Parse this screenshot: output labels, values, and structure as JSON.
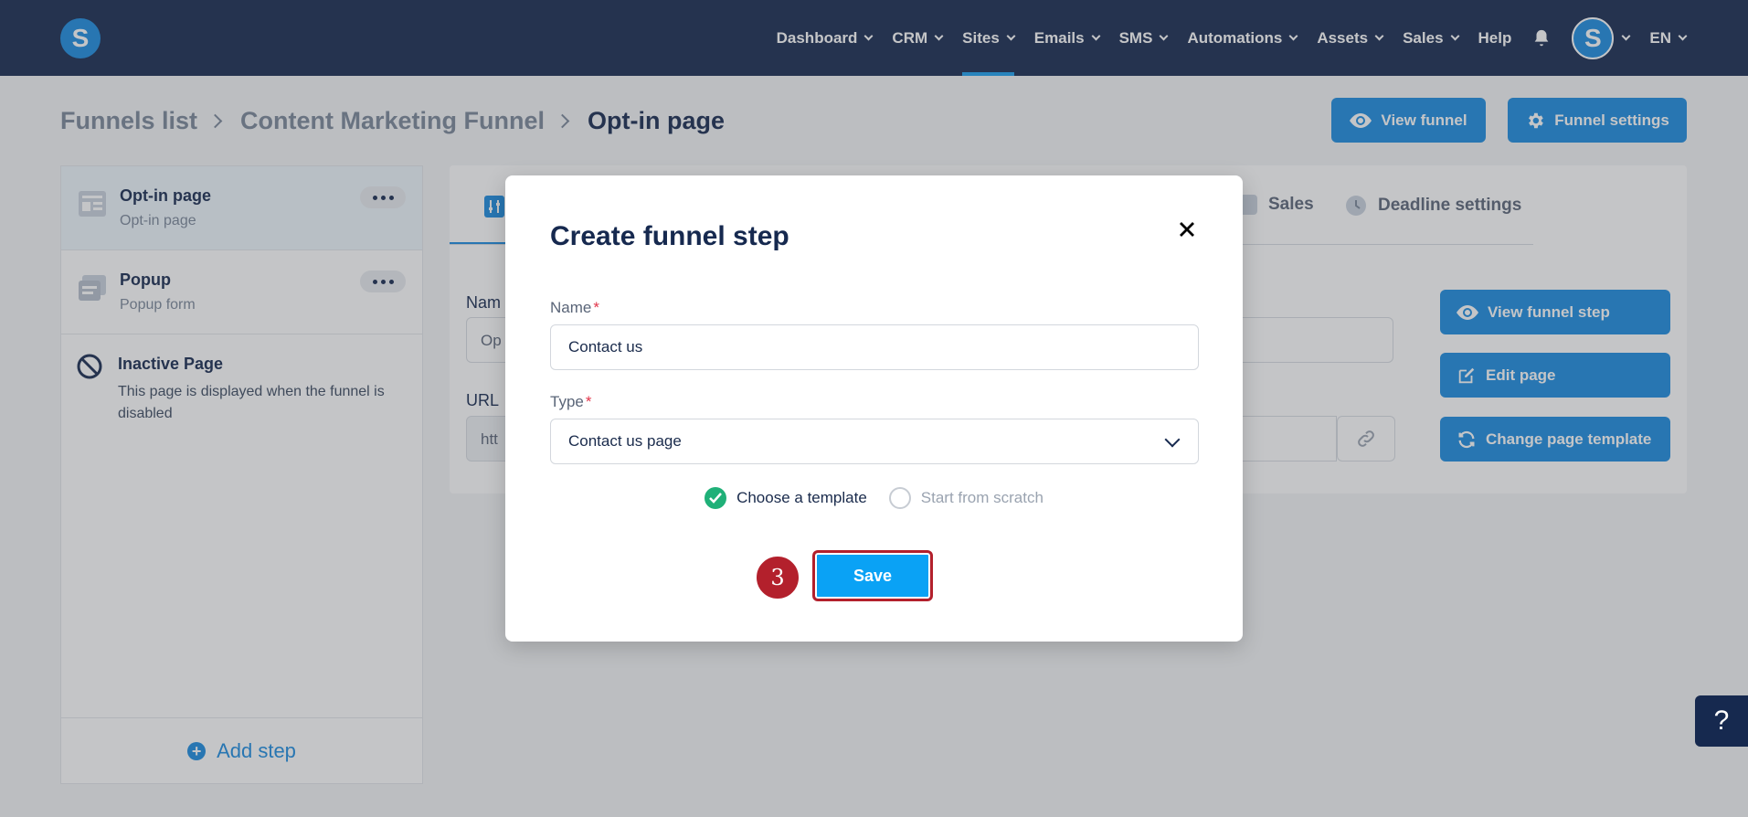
{
  "nav": {
    "logo_letter": "S",
    "items": [
      {
        "label": "Dashboard",
        "has_dropdown": true
      },
      {
        "label": "CRM",
        "has_dropdown": true
      },
      {
        "label": "Sites",
        "has_dropdown": true,
        "active": true
      },
      {
        "label": "Emails",
        "has_dropdown": true
      },
      {
        "label": "SMS",
        "has_dropdown": true
      },
      {
        "label": "Automations",
        "has_dropdown": true
      },
      {
        "label": "Assets",
        "has_dropdown": true
      },
      {
        "label": "Sales",
        "has_dropdown": true
      },
      {
        "label": "Help",
        "has_dropdown": false
      }
    ],
    "avatar_letter": "S",
    "language": "EN"
  },
  "breadcrumb": {
    "items": [
      "Funnels list",
      "Content Marketing Funnel"
    ],
    "current": "Opt-in page"
  },
  "header_actions": {
    "view_funnel": "View funnel",
    "funnel_settings": "Funnel settings"
  },
  "sidebar": {
    "steps": [
      {
        "title": "Opt-in page",
        "subtitle": "Opt-in page"
      },
      {
        "title": "Popup",
        "subtitle": "Popup form"
      }
    ],
    "inactive": {
      "title": "Inactive Page",
      "description": "This page is displayed when the funnel is disabled"
    },
    "add_step": "Add step"
  },
  "main": {
    "tabs": {
      "sales": "Sales",
      "deadline": "Deadline settings"
    },
    "name_label_partial": "Nam",
    "name_value_partial": "Op",
    "url_label_partial": "URL",
    "url_value_partial": "htt",
    "actions": {
      "view_step": "View funnel step",
      "edit_page": "Edit page",
      "change_template": "Change page template"
    }
  },
  "modal": {
    "title": "Create funnel step",
    "name_label": "Name",
    "name_value": "Contact us",
    "type_label": "Type",
    "type_value": "Contact us page",
    "required_mark": "*",
    "option_template": "Choose a template",
    "option_scratch": "Start from scratch",
    "selected_option": "Choose a template",
    "save_label": "Save",
    "step_badge": "3"
  },
  "help_label": "?",
  "colors": {
    "nav_bg": "#16294f",
    "primary": "#1a8be0",
    "save_button": "#0aa2f5",
    "highlight_red": "#b3202c",
    "check_green": "#1fb078"
  }
}
